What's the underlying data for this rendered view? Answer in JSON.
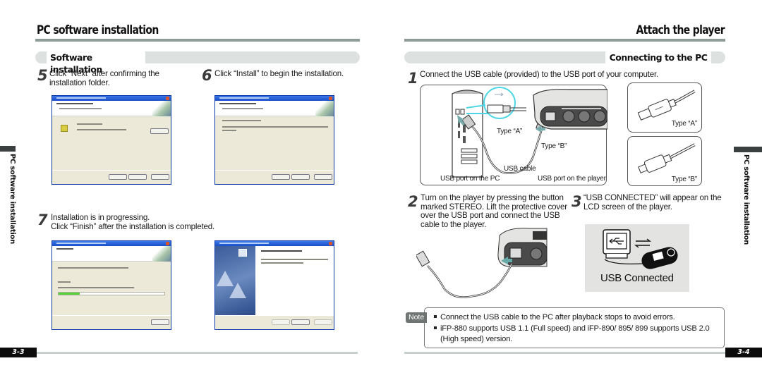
{
  "left_page": {
    "title": "PC software installation",
    "section": "Software installation",
    "side_tab": "PC software installation",
    "steps": [
      {
        "num": "5",
        "lines": [
          "Click “Next” after confirming the",
          "installation folder."
        ]
      },
      {
        "num": "6",
        "lines": [
          "Click “Install” to begin the installation."
        ]
      },
      {
        "num": "7",
        "lines": [
          "Installation is in progressing.",
          "Click “Finish” after the installation is completed."
        ]
      }
    ],
    "dialogs": [
      {
        "name": "choose-destination-location",
        "progress": null
      },
      {
        "name": "ready-to-install",
        "progress": null
      },
      {
        "name": "setup-status",
        "progress": 0.2
      },
      {
        "name": "installshield-wizard-complete",
        "progress": null
      }
    ],
    "page_number": "3-3"
  },
  "right_page": {
    "title": "Attach the player",
    "section": "Connecting to the PC",
    "side_tab": "PC software installation",
    "steps": [
      {
        "num": "1",
        "lines": [
          "Connect the USB cable (provided) to the USB port of your computer."
        ]
      },
      {
        "num": "2",
        "lines": [
          "Turn on the player by pressing the button",
          "marked STEREO. Lift the protective cover",
          "over the USB port and connect the USB",
          "cable to the player."
        ]
      },
      {
        "num": "3",
        "lines": [
          "“USB CONNECTED” will appear on the",
          "LCD screen of the player."
        ]
      }
    ],
    "diagram_captions": {
      "type_a": "Type “A”",
      "type_b": "Type “B”",
      "usb_cable": "USB cable",
      "usb_port_pc": "USB port on the PC",
      "usb_port_player": "USB port on the player"
    },
    "connector_captions": {
      "type_a": "Type “A”",
      "type_b": "Type “B”"
    },
    "usb_connected_label": "USB Connected",
    "note": {
      "badge": "Note",
      "items": [
        "Connect the USB cable to the PC after playback stops to avoid errors.",
        "iFP-880 supports USB 1.1 (Full speed) and iFP-890/ 895/ 899 supports USB 2.0",
        "(High speed) version."
      ]
    },
    "page_number": "3-4"
  },
  "colors": {
    "rule": "#8e9c98",
    "section_bar": "#dde1df",
    "page_number_bg": "#0c0c0c",
    "note_badge": "#6e7472",
    "xp_title_blue": "#1a4fc8",
    "xp_body": "#ece9d8",
    "progress_green": "#57d43c"
  }
}
